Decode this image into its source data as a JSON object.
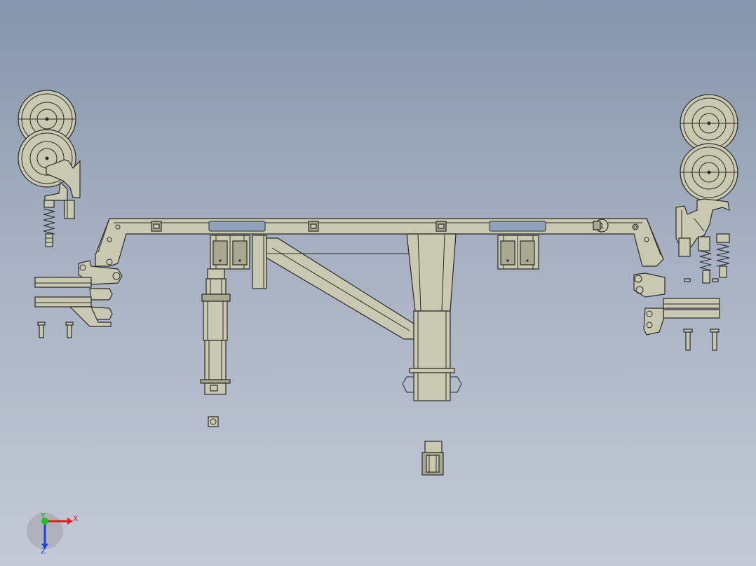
{
  "viewport": {
    "background_top": "#8695ab",
    "background_bottom": "#c4cad6",
    "part_color": "#c9c9b2",
    "edge_color": "#2a2a28"
  },
  "model": {
    "balloon_label": "1"
  },
  "triad": {
    "x_label": "X",
    "y_label": "Y",
    "z_label": "Z",
    "x_color": "#e02020",
    "y_color": "#20c020",
    "z_color": "#2040e0"
  }
}
